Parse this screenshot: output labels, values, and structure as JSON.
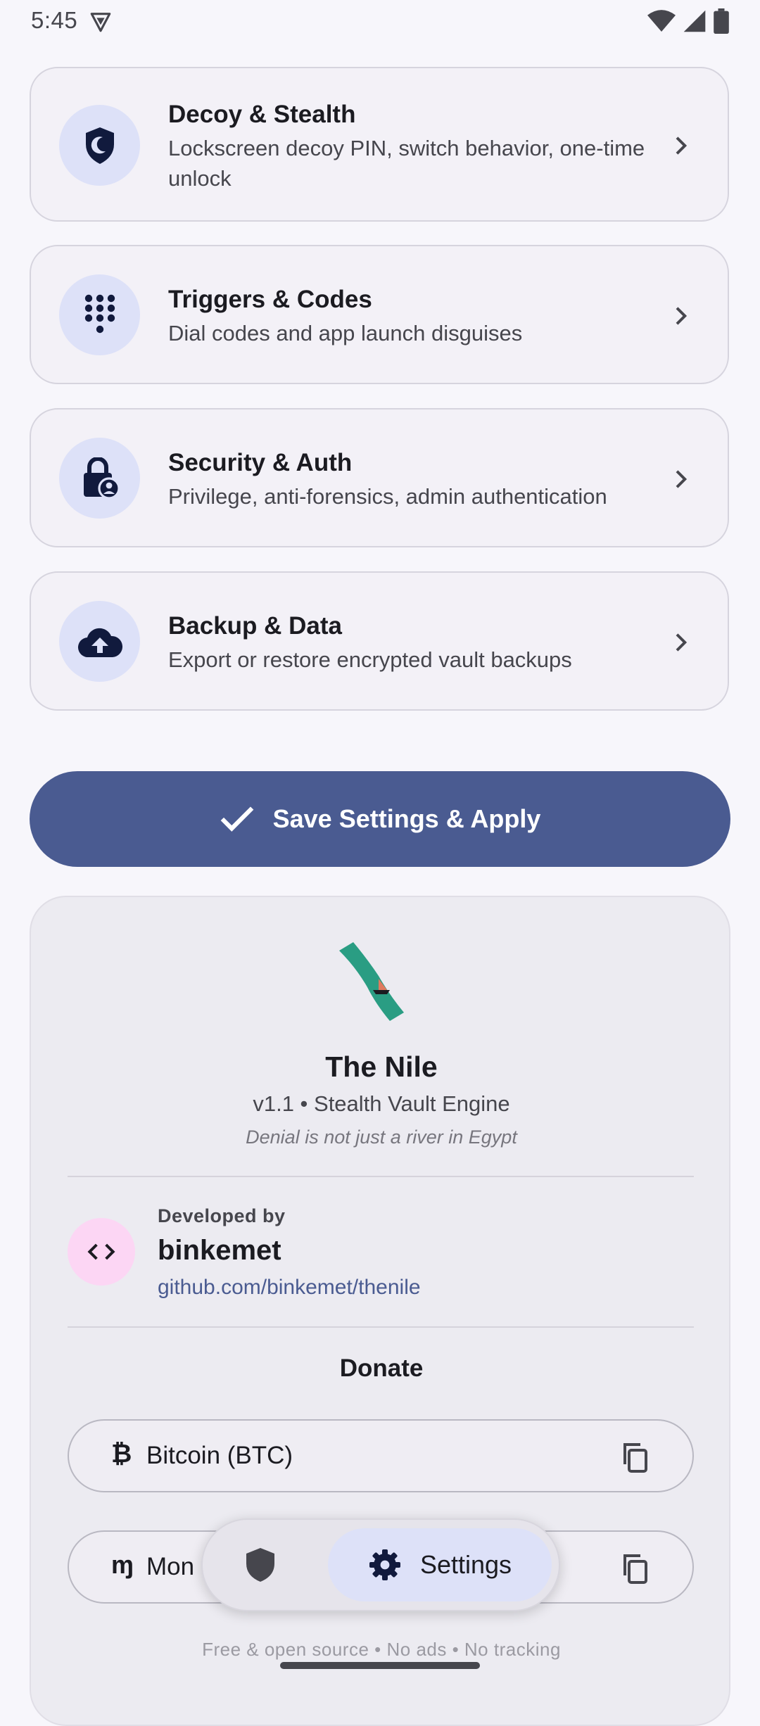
{
  "status_bar": {
    "time": "5:45"
  },
  "settings_cards": [
    {
      "title": "Decoy & Stealth",
      "subtitle": "Lockscreen decoy PIN, switch behavior, one-time unlock",
      "icon": "shield-moon-icon"
    },
    {
      "title": "Triggers & Codes",
      "subtitle": "Dial codes and app launch disguises",
      "icon": "dialpad-icon"
    },
    {
      "title": "Security & Auth",
      "subtitle": "Privilege, anti-forensics, admin authentication",
      "icon": "lock-person-icon"
    },
    {
      "title": "Backup & Data",
      "subtitle": "Export or restore encrypted vault backups",
      "icon": "cloud-upload-icon"
    }
  ],
  "save_button": {
    "label": "Save Settings & Apply"
  },
  "about": {
    "app_name": "The Nile",
    "version": "v1.1 • Stealth Vault Engine",
    "tagline": "Denial is not just a river in Egypt",
    "developer": {
      "caption": "Developed by",
      "name": "binkemet",
      "link": "github.com/binkemet/thenile"
    },
    "donate_title": "Donate",
    "donations": [
      {
        "symbol": "₿",
        "label": "Bitcoin (BTC)"
      },
      {
        "symbol": "ɱ",
        "label": "Mon"
      }
    ],
    "footer": "Free & open source • No ads • No tracking"
  },
  "bottom_nav": {
    "items": [
      {
        "icon": "shield-icon",
        "label": ""
      },
      {
        "icon": "gear-icon",
        "label": "Settings"
      }
    ]
  },
  "colors": {
    "accent": "#4a5b91",
    "badge_bg": "#dde1f8",
    "dev_avatar_bg": "#fcd6f4"
  }
}
